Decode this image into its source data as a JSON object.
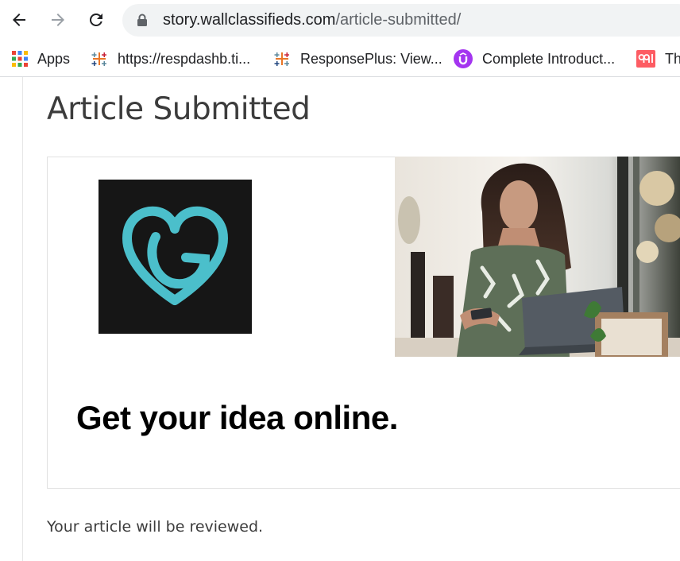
{
  "browser": {
    "url_host": "story.wallclassifieds.com",
    "url_path": "/article-submitted/",
    "bookmarks": [
      {
        "label": "Apps",
        "icon": "apps-grid-icon"
      },
      {
        "label": "https://respdashb.ti...",
        "icon": "tableau-icon"
      },
      {
        "label": "ResponsePlus: View...",
        "icon": "tableau-icon"
      },
      {
        "label": "Complete Introduct...",
        "icon": "udemy-icon"
      },
      {
        "label": "Th",
        "icon": "99designs-icon"
      }
    ]
  },
  "page": {
    "title": "Article Submitted",
    "ad": {
      "headline": "Get your idea online.",
      "logo_icon": "godaddy-heart-logo",
      "brand_color": "#4bbfcb"
    },
    "review_note": "Your article will be reviewed."
  }
}
